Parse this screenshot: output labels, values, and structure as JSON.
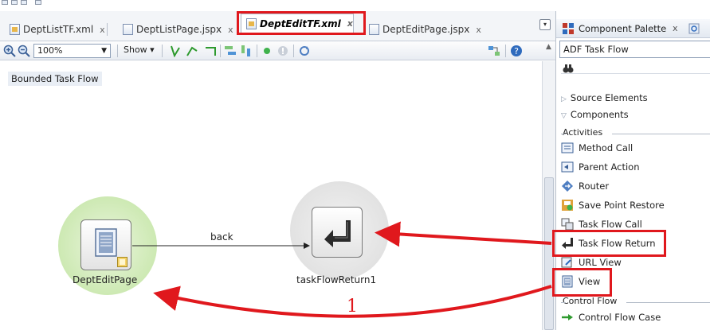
{
  "editor_tabs": [
    {
      "label": "DeptListTF.xml",
      "close": "x"
    },
    {
      "label": "DeptListPage.jspx",
      "close": "x"
    },
    {
      "label": "DeptEditTF.xml",
      "close": "x",
      "active": true
    },
    {
      "label": "DeptEditPage.jspx",
      "close": "x"
    }
  ],
  "toolbar": {
    "zoom_value": "100%",
    "show_label": "Show ▾"
  },
  "canvas": {
    "tag_label": "Bounded Task Flow",
    "nodes": [
      {
        "label": "DeptEditPage",
        "icon": "view-page-icon"
      },
      {
        "label": "taskFlowReturn1",
        "icon": "task-flow-return-icon"
      }
    ],
    "edge_label": "back"
  },
  "palette": {
    "title": "Component Palette",
    "close": "x",
    "selected": "ADF Task Flow",
    "sections": {
      "source_elements": "Source Elements",
      "components": "Components",
      "activities": "Activities",
      "control_flow": "Control Flow"
    },
    "activity_items": [
      {
        "label": "Method Call",
        "icon": "method-call-icon"
      },
      {
        "label": "Parent Action",
        "icon": "parent-action-icon"
      },
      {
        "label": "Router",
        "icon": "router-icon"
      },
      {
        "label": "Save Point Restore",
        "icon": "save-point-restore-icon"
      },
      {
        "label": "Task Flow Call",
        "icon": "task-flow-call-icon"
      },
      {
        "label": "Task Flow Return",
        "icon": "task-flow-return-icon"
      },
      {
        "label": "URL View",
        "icon": "url-view-icon"
      },
      {
        "label": "View",
        "icon": "view-icon"
      }
    ],
    "control_flow_items": [
      {
        "label": "Control Flow Case",
        "icon": "control-flow-case-icon"
      }
    ]
  },
  "annotation": {
    "step_number": "1",
    "color": "#e0181d"
  }
}
